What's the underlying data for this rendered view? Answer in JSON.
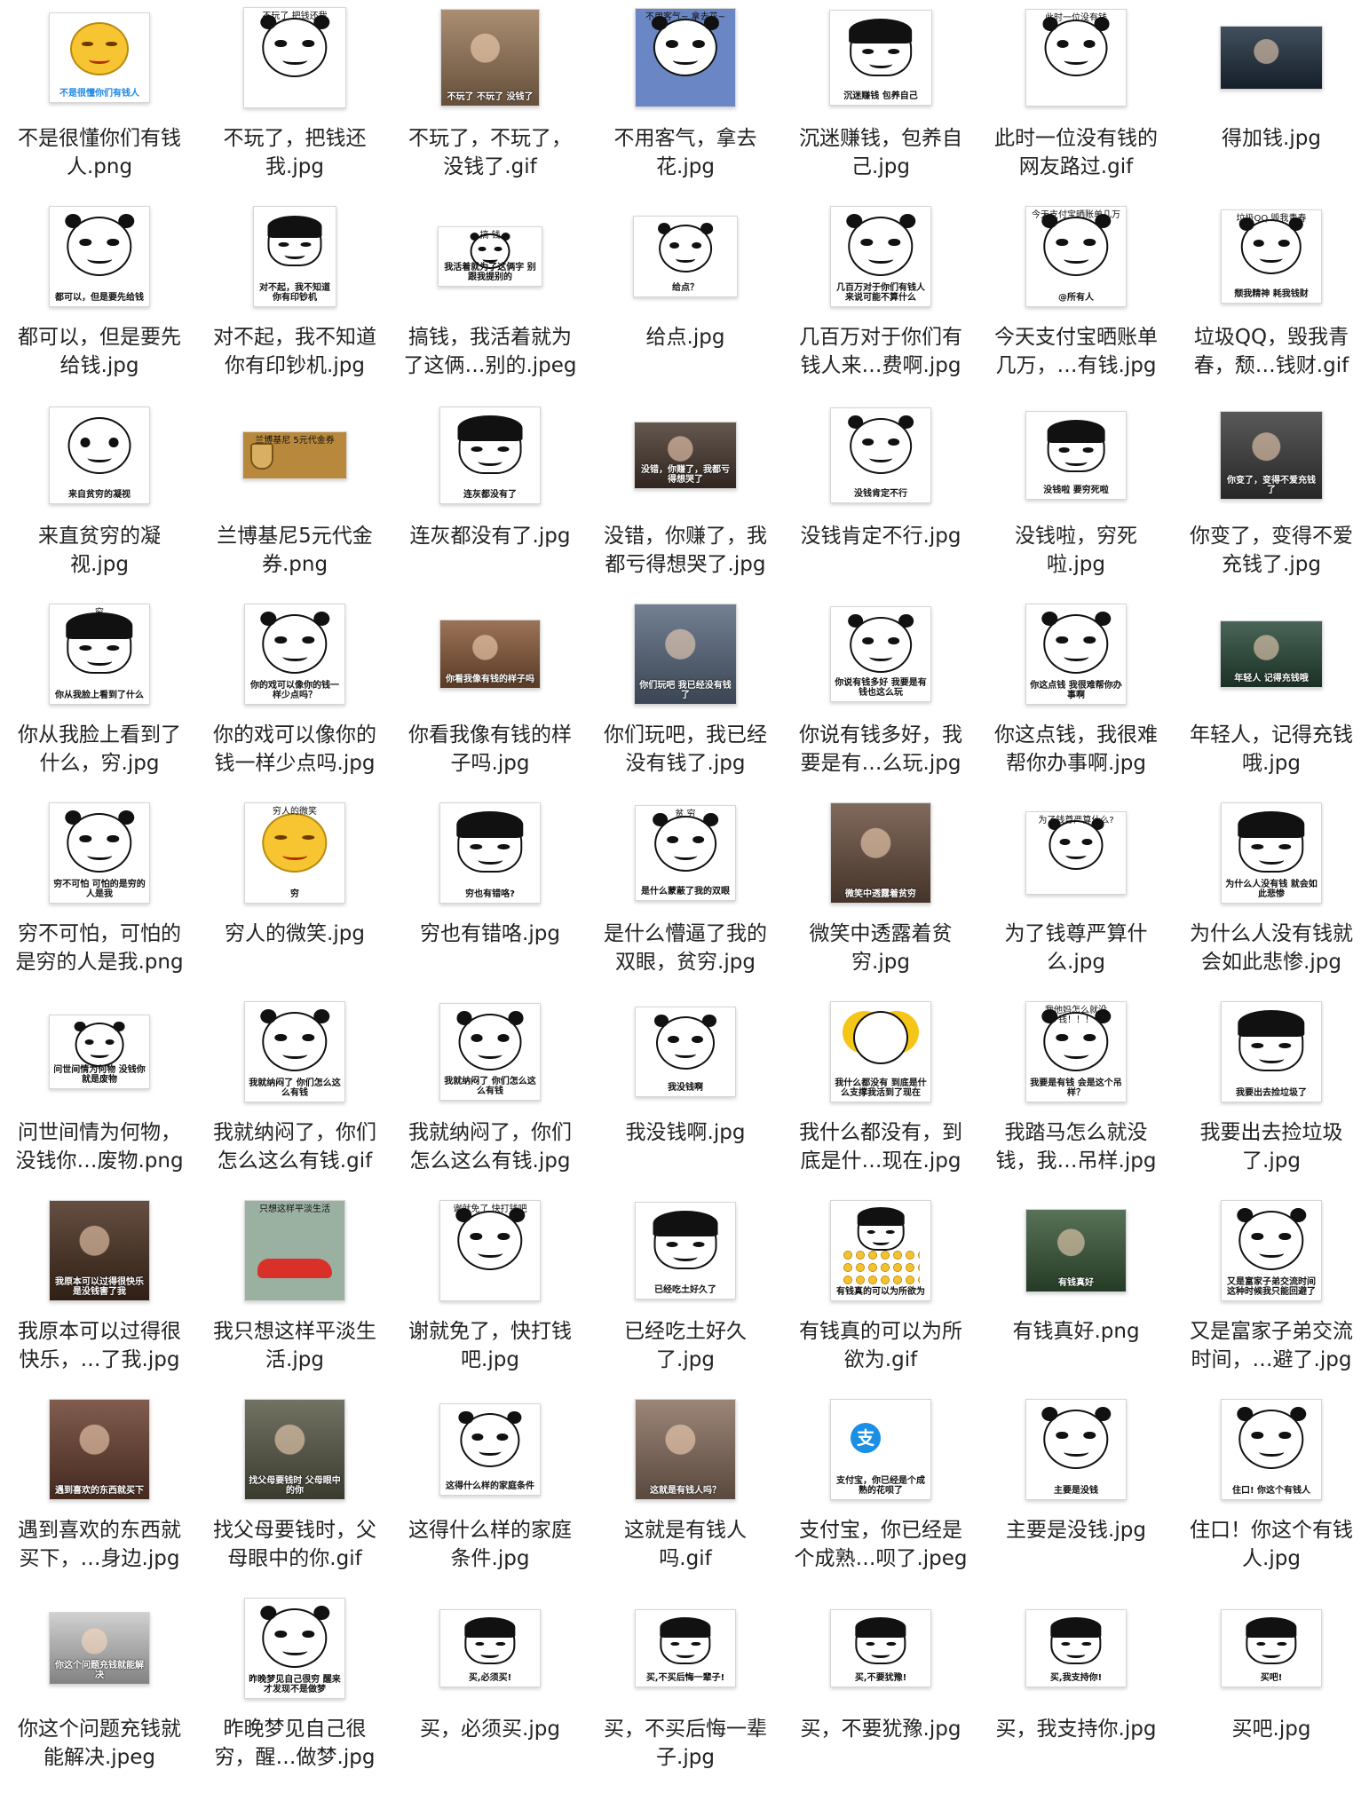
{
  "files": [
    {
      "name": "不是很懂你们有钱人.png",
      "lines": [
        "不是很懂你们有钱",
        "人.png"
      ],
      "thumb": {
        "kind": "smile",
        "w": 112,
        "h": 100,
        "bg": "#ffffff",
        "cap": "不是很懂你们有钱人",
        "capColor": "#1e88e5"
      }
    },
    {
      "name": "不玩了，把钱还我.jpg",
      "lines": [
        "不玩了，把钱还",
        "我.jpg"
      ],
      "thumb": {
        "kind": "panda",
        "w": 114,
        "h": 112,
        "bg": "#ffffff",
        "top": "不玩了  把钱还我"
      }
    },
    {
      "name": "不玩了，不玩了，没钱了.gif",
      "lines": [
        "不玩了，不玩了，",
        "没钱了.gif"
      ],
      "thumb": {
        "kind": "photo",
        "w": 110,
        "h": 108,
        "bg": "#9b7a5a",
        "cap": "不玩了 不玩了 没钱了"
      }
    },
    {
      "name": "不用客气，拿去花.jpg",
      "lines": [
        "不用客气，拿去",
        "花.jpg"
      ],
      "thumb": {
        "kind": "panda",
        "w": 112,
        "h": 110,
        "bg": "#6b86c4",
        "top": "不用客气~ 拿去花~"
      }
    },
    {
      "name": "沉迷赚钱，包养自己.jpg",
      "lines": [
        "沉迷赚钱，包养自",
        "己.jpg"
      ],
      "thumb": {
        "kind": "mush",
        "w": 114,
        "h": 106,
        "bg": "#ffffff",
        "cap": "沉迷赚钱 包养自己"
      }
    },
    {
      "name": "此时一位没有钱的网友路过.gif",
      "lines": [
        "此时一位没有钱的",
        "网友路过.gif"
      ],
      "thumb": {
        "kind": "panda",
        "w": 112,
        "h": 108,
        "bg": "#ffffff",
        "top": "此时一位没有钱"
      }
    },
    {
      "name": "得加钱.jpg",
      "lines": [
        "得加钱.jpg"
      ],
      "thumb": {
        "kind": "photo",
        "w": 114,
        "h": 70,
        "bg": "#203040",
        "cap": ""
      }
    },
    {
      "name": "都可以，但是要先给钱.jpg",
      "lines": [
        "都可以，但是要先",
        "给钱.jpg"
      ],
      "thumb": {
        "kind": "panda",
        "w": 112,
        "h": 112,
        "bg": "#ffffff",
        "cap": "都可以，但是要先给钱"
      }
    },
    {
      "name": "对不起，我不知道你有印钞机.jpg",
      "lines": [
        "对不起，我不知道",
        "你有印钞机.jpg"
      ],
      "thumb": {
        "kind": "mush",
        "w": 92,
        "h": 112,
        "bg": "#ffffff",
        "cap": "对不起，我不知道你有印钞机"
      }
    },
    {
      "name": "搞钱，我活着就为了这俩...别的.jpeg",
      "lines": [
        "搞钱，我活着就为",
        "了这俩…别的.jpeg"
      ],
      "thumb": {
        "kind": "panda",
        "w": 116,
        "h": 66,
        "bg": "#ffffff",
        "top": "搞            钱",
        "cap": "我活着就为了这俩字 别跟我提别的"
      }
    },
    {
      "name": "给点.jpg",
      "lines": [
        "给点.jpg"
      ],
      "thumb": {
        "kind": "panda",
        "w": 116,
        "h": 90,
        "bg": "#ffffff",
        "cap": "给点？"
      }
    },
    {
      "name": "几百万对于你们有钱人来...费啊.jpg",
      "lines": [
        "几百万对于你们有",
        "钱人来…费啊.jpg"
      ],
      "thumb": {
        "kind": "panda",
        "w": 112,
        "h": 112,
        "bg": "#ffffff",
        "cap": "几百万对于你们有钱人来说可能不算什么"
      }
    },
    {
      "name": "今天支付宝晒账单几万，...有钱.jpg",
      "lines": [
        "今天支付宝晒账单",
        "几万，…有钱.jpg"
      ],
      "thumb": {
        "kind": "panda",
        "w": 112,
        "h": 112,
        "bg": "#ffffff",
        "top": "今天支付宝晒账单几万",
        "cap": "@所有人"
      }
    },
    {
      "name": "垃圾QQ，毁我青春，颓...钱财.gif",
      "lines": [
        "垃圾QQ，毁我青",
        "春，颓…钱财.gif"
      ],
      "thumb": {
        "kind": "panda",
        "w": 112,
        "h": 104,
        "bg": "#ffffff",
        "top": "垃圾QQ 毁我青春",
        "cap": "颓我精神  耗我钱财"
      }
    },
    {
      "name": "来直贫穷的凝视.jpg",
      "lines": [
        "来直贫穷的凝",
        "视.jpg"
      ],
      "thumb": {
        "kind": "blank",
        "w": 112,
        "h": 108,
        "bg": "#ffffff",
        "cap": "来自贫穷的凝视"
      }
    },
    {
      "name": "兰博基尼5元代金券.png",
      "lines": [
        "兰博基尼5元代金",
        "券.png"
      ],
      "thumb": {
        "kind": "coupon",
        "w": 116,
        "h": 52,
        "bg": "#b8893c",
        "top": "兰博基尼 5元代金券"
      }
    },
    {
      "name": "连灰都没有了.jpg",
      "lines": [
        "连灰都没有了.jpg"
      ],
      "thumb": {
        "kind": "mush",
        "w": 112,
        "h": 108,
        "bg": "#ffffff",
        "cap": "连灰都没有了"
      }
    },
    {
      "name": "没错，你赚了，我都亏得想哭了.jpg",
      "lines": [
        "没错，你赚了，我",
        "都亏得想哭了.jpg"
      ],
      "thumb": {
        "kind": "photo",
        "w": 114,
        "h": 74,
        "bg": "#4a3a30",
        "cap": "没错，你赚了，我都亏得想哭了"
      }
    },
    {
      "name": "没钱肯定不行.jpg",
      "lines": [
        "没钱肯定不行.jpg"
      ],
      "thumb": {
        "kind": "panda",
        "w": 112,
        "h": 106,
        "bg": "#ffffff",
        "cap": "没钱肯定不行"
      }
    },
    {
      "name": "没钱啦，穷死啦.jpg",
      "lines": [
        "没钱啦，穷死",
        "啦.jpg"
      ],
      "thumb": {
        "kind": "mush",
        "w": 112,
        "h": 98,
        "bg": "#ffffff",
        "cap": "没钱啦 要穷死啦"
      }
    },
    {
      "name": "你变了，变得不爱充钱了.jpg",
      "lines": [
        "你变了，变得不爱",
        "充钱了.jpg"
      ],
      "thumb": {
        "kind": "photo",
        "w": 114,
        "h": 98,
        "bg": "#3c3c3c",
        "cap": "你变了，变得不爱充钱了"
      }
    },
    {
      "name": "你从我脸上看到了什么，穷.jpg",
      "lines": [
        "你从我脸上看到了",
        "什么，穷.jpg"
      ],
      "thumb": {
        "kind": "mush",
        "w": 112,
        "h": 112,
        "bg": "#ffffff",
        "top": "穷",
        "cap": "你从我脸上看到了什么"
      }
    },
    {
      "name": "你的戏可以像你的钱一样少点吗.jpg",
      "lines": [
        "你的戏可以像你的",
        "钱一样少点吗.jpg"
      ],
      "thumb": {
        "kind": "panda",
        "w": 112,
        "h": 112,
        "bg": "#ffffff",
        "cap": "你的戏可以像你的钱一样少点吗？"
      }
    },
    {
      "name": "你看我像有钱的样子吗.jpg",
      "lines": [
        "你看我像有钱的样",
        "子吗.jpg"
      ],
      "thumb": {
        "kind": "photo",
        "w": 112,
        "h": 76,
        "bg": "#8a5a3a",
        "cap": "你看我像有钱的样子吗"
      }
    },
    {
      "name": "你们玩吧，我已经没有钱了.jpg",
      "lines": [
        "你们玩吧，我已经",
        "没有钱了.jpg"
      ],
      "thumb": {
        "kind": "photo",
        "w": 114,
        "h": 112,
        "bg": "#5a6a80",
        "cap": "你们玩吧 我已经没有钱了"
      }
    },
    {
      "name": "你说有钱多好，我要是有...么玩.jpg",
      "lines": [
        "你说有钱多好，我",
        "要是有…么玩.jpg"
      ],
      "thumb": {
        "kind": "panda",
        "w": 112,
        "h": 106,
        "bg": "#ffffff",
        "cap": "你说有钱多好 我要是有钱也这么玩"
      }
    },
    {
      "name": "你这点钱，我很难帮你办事啊.jpg",
      "lines": [
        "你这点钱，我很难",
        "帮你办事啊.jpg"
      ],
      "thumb": {
        "kind": "panda",
        "w": 112,
        "h": 112,
        "bg": "#ffffff",
        "cap": "你这点钱 我很难帮你办事啊"
      }
    },
    {
      "name": "年轻人，记得充钱哦.jpg",
      "lines": [
        "年轻人，记得充钱",
        "哦.jpg"
      ],
      "thumb": {
        "kind": "photo",
        "w": 114,
        "h": 74,
        "bg": "#2a4a3a",
        "cap": "年轻人 记得充钱哦"
      }
    },
    {
      "name": "穷不可怕，可怕的是穷的人是我.png",
      "lines": [
        "穷不可怕，可怕的",
        "是穷的人是我.png"
      ],
      "thumb": {
        "kind": "panda",
        "w": 112,
        "h": 112,
        "bg": "#ffffff",
        "cap": "穷不可怕 可怕的是穷的人是我"
      }
    },
    {
      "name": "穷人的微笑.jpg",
      "lines": [
        "穷人的微笑.jpg"
      ],
      "thumb": {
        "kind": "smile",
        "w": 112,
        "h": 112,
        "bg": "#ffffff",
        "top": "穷人的微笑",
        "cap": "穷"
      }
    },
    {
      "name": "穷也有错咯.jpg",
      "lines": [
        "穷也有错咯.jpg"
      ],
      "thumb": {
        "kind": "mush",
        "w": 112,
        "h": 112,
        "bg": "#ffffff",
        "cap": "穷也有错咯?"
      }
    },
    {
      "name": "是什么懵逼了我的双眼，贫穷.jpg",
      "lines": [
        "是什么懵逼了我的",
        "双眼，贫穷.jpg"
      ],
      "thumb": {
        "kind": "panda",
        "w": 112,
        "h": 106,
        "bg": "#ffffff",
        "top": "贫  穷",
        "cap": "是什么蒙蔽了我的双眼"
      }
    },
    {
      "name": "微笑中透露着贫穷.jpg",
      "lines": [
        "微笑中透露着贫",
        "穷.jpg"
      ],
      "thumb": {
        "kind": "photo",
        "w": 112,
        "h": 112,
        "bg": "#6a5040",
        "cap": "微笑中透露着贫穷"
      }
    },
    {
      "name": "为了钱尊严算什么.jpg",
      "lines": [
        "为了钱尊严算什",
        "么.jpg"
      ],
      "thumb": {
        "kind": "panda",
        "w": 112,
        "h": 92,
        "bg": "#ffffff",
        "top": "为了钱尊严算什么?"
      }
    },
    {
      "name": "为什么人没有钱就会如此悲惨.jpg",
      "lines": [
        "为什么人没有钱就",
        "会如此悲惨.jpg"
      ],
      "thumb": {
        "kind": "mush",
        "w": 112,
        "h": 112,
        "bg": "#ffffff",
        "cap": "为什么人没有钱 就会如此悲惨"
      }
    },
    {
      "name": "问世间情为何物，没钱你...废物.png",
      "lines": [
        "问世间情为何物，",
        "没钱你…废物.png"
      ],
      "thumb": {
        "kind": "panda",
        "w": 112,
        "h": 82,
        "bg": "#ffffff",
        "cap": "问世间情为何物 没钱你就是废物"
      }
    },
    {
      "name": "我就纳闷了，你们怎么这么有钱.gif",
      "lines": [
        "我就纳闷了，你们",
        "怎么这么有钱.gif"
      ],
      "thumb": {
        "kind": "panda",
        "w": 112,
        "h": 112,
        "bg": "#ffffff",
        "cap": "我就纳闷了 你们怎么这么有钱"
      }
    },
    {
      "name": "我就纳闷了，你们怎么这么有钱.jpg",
      "lines": [
        "我就纳闷了，你们",
        "怎么这么有钱.jpg"
      ],
      "thumb": {
        "kind": "panda",
        "w": 112,
        "h": 108,
        "bg": "#ffffff",
        "cap": "我就纳闷了 你们怎么这么有钱"
      }
    },
    {
      "name": "我没钱啊.jpg",
      "lines": [
        "我没钱啊.jpg"
      ],
      "thumb": {
        "kind": "panda",
        "w": 112,
        "h": 100,
        "bg": "#ffffff",
        "cap": "我没钱啊"
      }
    },
    {
      "name": "我什么都没有，到底是什...现在.jpg",
      "lines": [
        "我什么都没有，到",
        "底是什…现在.jpg"
      ],
      "thumb": {
        "kind": "girl",
        "w": 112,
        "h": 112,
        "bg": "#ffffff",
        "cap": "我什么都没有 到底是什么支撑我活到了现在"
      }
    },
    {
      "name": "我踏马怎么就没钱，我...吊样.jpg",
      "lines": [
        "我踏马怎么就没",
        "钱，我…吊样.jpg"
      ],
      "thumb": {
        "kind": "panda",
        "w": 112,
        "h": 112,
        "bg": "#ffffff",
        "top": "我他妈怎么就没钱！！！",
        "cap": "我要是有钱 会是这个吊样？"
      }
    },
    {
      "name": "我要出去捡垃圾了.jpg",
      "lines": [
        "我要出去捡垃圾",
        "了.jpg"
      ],
      "thumb": {
        "kind": "mush",
        "w": 112,
        "h": 112,
        "bg": "#ffffff",
        "cap": "我要出去捡垃圾了"
      }
    },
    {
      "name": "我原本可以过得很快乐，...了我.jpg",
      "lines": [
        "我原本可以过得很",
        "快乐，…了我.jpg"
      ],
      "thumb": {
        "kind": "photo",
        "w": 112,
        "h": 112,
        "bg": "#4a3020",
        "cap": "我原本可以过得很快乐 是没钱害了我"
      }
    },
    {
      "name": "我只想这样平淡生活.jpg",
      "lines": [
        "我只想这样平淡生",
        "活.jpg"
      ],
      "thumb": {
        "kind": "car",
        "w": 112,
        "h": 112,
        "bg": "#9ab0a0",
        "top": "只想这样平淡生活"
      }
    },
    {
      "name": "谢就免了，快打钱吧.jpg",
      "lines": [
        "谢就免了，快打钱",
        "吧.jpg"
      ],
      "thumb": {
        "kind": "panda",
        "w": 112,
        "h": 112,
        "bg": "#ffffff",
        "top": "谢就免了 快打钱吧"
      }
    },
    {
      "name": "已经吃土好久了.jpg",
      "lines": [
        "已经吃土好久",
        "了.jpg"
      ],
      "thumb": {
        "kind": "mush",
        "w": 112,
        "h": 108,
        "bg": "#ffffff",
        "cap": "已经吃土好久了"
      }
    },
    {
      "name": "有钱真的可以为所欲为.gif",
      "lines": [
        "有钱真的可以为所",
        "欲为.gif"
      ],
      "thumb": {
        "kind": "coins",
        "w": 112,
        "h": 112,
        "bg": "#ffffff",
        "cap": "有钱真的可以为所欲为"
      }
    },
    {
      "name": "有钱真好.png",
      "lines": [
        "有钱真好.png"
      ],
      "thumb": {
        "kind": "photo",
        "w": 112,
        "h": 92,
        "bg": "#3a5a3a",
        "cap": "有钱真好"
      }
    },
    {
      "name": "又是富家子弟交流时间，...避了.jpg",
      "lines": [
        "又是富家子弟交流",
        "时间，…避了.jpg"
      ],
      "thumb": {
        "kind": "panda",
        "w": 112,
        "h": 112,
        "bg": "#ffffff",
        "cap": "又是富家子弟交流时间 这种时候我只能回避了"
      }
    },
    {
      "name": "遇到喜欢的东西就买下，...身边.jpg",
      "lines": [
        "遇到喜欢的东西就",
        "买下，…身边.jpg"
      ],
      "thumb": {
        "kind": "photo",
        "w": 112,
        "h": 112,
        "bg": "#6a4030",
        "cap": "遇到喜欢的东西就买下"
      }
    },
    {
      "name": "找父母要钱时，父母眼中的你.gif",
      "lines": [
        "找父母要钱时，父",
        "母眼中的你.gif"
      ],
      "thumb": {
        "kind": "photo",
        "w": 112,
        "h": 112,
        "bg": "#5a5a48",
        "cap": "找父母要钱时 父母眼中的你"
      }
    },
    {
      "name": "这得什么样的家庭条件.jpg",
      "lines": [
        "这得什么样的家庭",
        "条件.jpg"
      ],
      "thumb": {
        "kind": "panda",
        "w": 112,
        "h": 102,
        "bg": "#ffffff",
        "cap": "这得什么样的家庭条件"
      }
    },
    {
      "name": "这就是有钱人吗.gif",
      "lines": [
        "这就是有钱人",
        "吗.gif"
      ],
      "thumb": {
        "kind": "photo",
        "w": 112,
        "h": 112,
        "bg": "#8a7060",
        "cap": "这就是有钱人吗？"
      }
    },
    {
      "name": "支付宝，你已经是个成熟...呗了.jpeg",
      "lines": [
        "支付宝，你已经是",
        "个成熟…呗了.jpeg"
      ],
      "thumb": {
        "kind": "alipay",
        "w": 112,
        "h": 112,
        "bg": "#ffffff",
        "cap": "支付宝，你已经是个成熟的花呗了"
      }
    },
    {
      "name": "主要是没钱.jpg",
      "lines": [
        "主要是没钱.jpg"
      ],
      "thumb": {
        "kind": "panda",
        "w": 112,
        "h": 112,
        "bg": "#ffffff",
        "cap": "主要是没钱"
      }
    },
    {
      "name": "住口！你这个有钱人.jpg",
      "lines": [
        "住口！你这个有钱",
        "人.jpg"
      ],
      "thumb": {
        "kind": "panda",
        "w": 112,
        "h": 112,
        "bg": "#ffffff",
        "cap": "住口! 你这个有钱人"
      }
    },
    {
      "name": "你这个问题充钱就能解决.jpeg",
      "lines": [
        "你这个问题充钱就",
        "能解决.jpeg"
      ],
      "thumb": {
        "kind": "photo",
        "w": 112,
        "h": 80,
        "bg": "#c8c8c8",
        "cap": "你这个问题充钱就能解决"
      }
    },
    {
      "name": "昨晚梦见自己很穷，醒...做梦.jpg",
      "lines": [
        "昨晚梦见自己很",
        "穷，醒…做梦.jpg"
      ],
      "thumb": {
        "kind": "panda",
        "w": 112,
        "h": 112,
        "bg": "#ffffff",
        "cap": "昨晚梦见自己很穷 醒来才发现不是做梦"
      }
    },
    {
      "name": "买，必须买.jpg",
      "lines": [
        "买，必须买.jpg"
      ],
      "thumb": {
        "kind": "mush",
        "w": 112,
        "h": 86,
        "bg": "#ffffff",
        "cap": "买,必须买!"
      }
    },
    {
      "name": "买，不买后悔一辈子.jpg",
      "lines": [
        "买，不买后悔一辈",
        "子.jpg"
      ],
      "thumb": {
        "kind": "mush",
        "w": 112,
        "h": 86,
        "bg": "#ffffff",
        "cap": "买,不买后悔一辈子!"
      }
    },
    {
      "name": "买，不要犹豫.jpg",
      "lines": [
        "买，不要犹豫.jpg"
      ],
      "thumb": {
        "kind": "mush",
        "w": 112,
        "h": 86,
        "bg": "#ffffff",
        "cap": "买,不要犹豫!"
      }
    },
    {
      "name": "买，我支持你.jpg",
      "lines": [
        "买，我支持你.jpg"
      ],
      "thumb": {
        "kind": "mush",
        "w": 112,
        "h": 86,
        "bg": "#ffffff",
        "cap": "买,我支持你!"
      }
    },
    {
      "name": "买吧.jpg",
      "lines": [
        "买吧.jpg"
      ],
      "thumb": {
        "kind": "mush",
        "w": 112,
        "h": 86,
        "bg": "#ffffff",
        "cap": "买吧!"
      }
    }
  ]
}
